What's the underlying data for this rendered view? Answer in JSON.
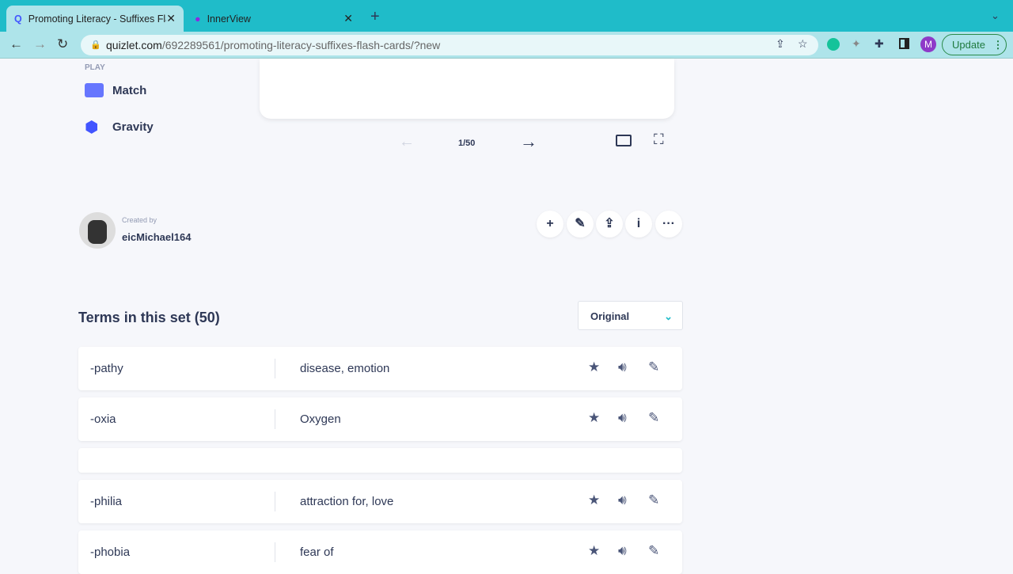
{
  "browser": {
    "tabs": [
      {
        "title": "Promoting Literacy - Suffixes Flash Cards"
      },
      {
        "title": "InnerView"
      }
    ],
    "url_domain": "quizlet.com",
    "url_path": "/692289561/promoting-literacy-suffixes-flash-cards/?new",
    "update_label": "Update",
    "profile_initial": "M"
  },
  "sidebar": {
    "section": "PLAY",
    "items": [
      {
        "label": "Match"
      },
      {
        "label": "Gravity"
      }
    ]
  },
  "flashcard": {
    "counter": "1/50"
  },
  "creator": {
    "caption": "Created by",
    "name": "eicMichael164"
  },
  "terms": {
    "title": "Terms in this set (50)",
    "sort": "Original",
    "rows": [
      {
        "term": "-pathy",
        "definition": "disease, emotion"
      },
      {
        "term": "-oxia",
        "definition": "Oxygen"
      },
      {
        "term": "",
        "definition": ""
      },
      {
        "term": "-philia",
        "definition": "attraction for, love"
      },
      {
        "term": "-phobia",
        "definition": "fear of"
      }
    ]
  },
  "colors": {
    "chrome": "#1fbcc9",
    "accent": "#4255ff"
  }
}
